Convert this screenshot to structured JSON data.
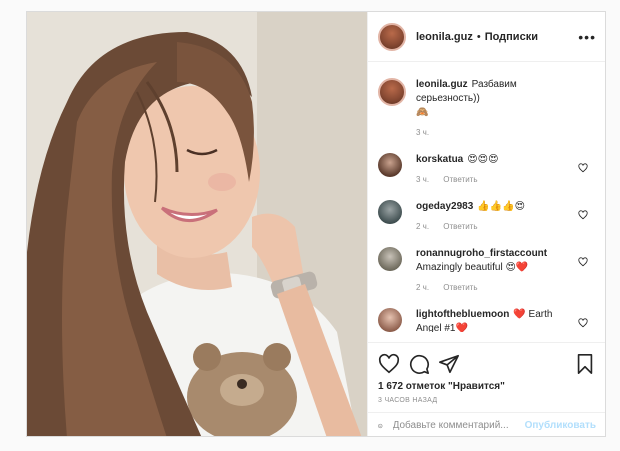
{
  "header": {
    "username": "leonila.guz",
    "separator": "•",
    "follow_label": "Подписки",
    "more_icon": "ellipsis-icon"
  },
  "caption": {
    "username": "leonila.guz",
    "text": "Разбавим серьезность))",
    "emoji": "🙈",
    "time": "3 ч."
  },
  "comments": [
    {
      "username": "korskatua",
      "text": "😍😍😍",
      "time": "3 ч.",
      "reply": "Ответить"
    },
    {
      "username": "ogeday2983",
      "text": "👍👍👍😍",
      "time": "2 ч.",
      "reply": "Ответить"
    },
    {
      "username": "ronannugroho_firstaccount",
      "text": "Amazingly beautiful 😍❤️",
      "time": "2 ч.",
      "reply": "Ответить"
    },
    {
      "username": "lightofthebluemoon",
      "text": "❤️ Earth Angel #1❤️",
      "time": "",
      "reply": ""
    }
  ],
  "actions": {
    "like_icon": "heart-outline-icon",
    "comment_icon": "comment-bubble-icon",
    "share_icon": "paper-plane-icon",
    "save_icon": "bookmark-icon"
  },
  "likes": "1 672 отметок \"Нравится\"",
  "posted": "3 часов назад",
  "add_comment": {
    "emoji_icon": "smiley-icon",
    "placeholder": "Добавьте комментарий...",
    "post_label": "Опубликовать"
  },
  "colors": {
    "link_disabled": "#b2dffc",
    "meta_gray": "#8e8e8e",
    "border": "#dbdbdb"
  }
}
